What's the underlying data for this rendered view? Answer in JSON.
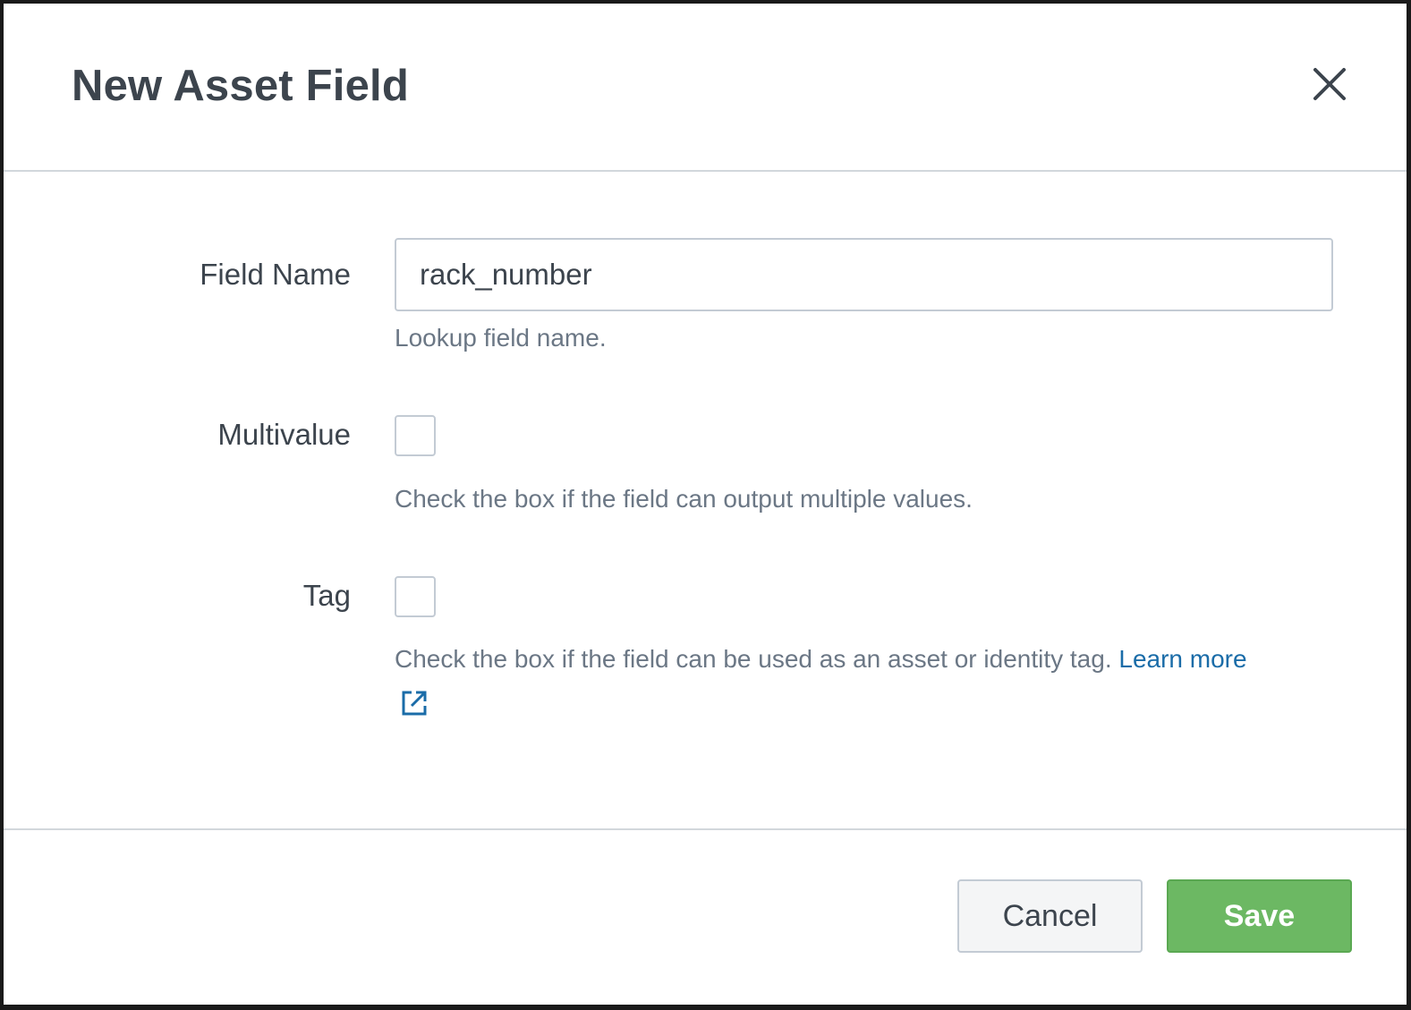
{
  "dialog": {
    "title": "New Asset Field"
  },
  "fields": {
    "field_name": {
      "label": "Field Name",
      "value": "rack_number",
      "help": "Lookup field name."
    },
    "multivalue": {
      "label": "Multivalue",
      "checked": false,
      "help": "Check the box if the field can output multiple values."
    },
    "tag": {
      "label": "Tag",
      "checked": false,
      "help": "Check the box if the field can be used as an asset or identity tag.",
      "link_text": "Learn more"
    }
  },
  "footer": {
    "cancel_label": "Cancel",
    "save_label": "Save"
  },
  "colors": {
    "save_green": "#6cb863",
    "link_blue": "#1a6ca8",
    "title_text": "#3c444d"
  },
  "icons": {
    "close": "close-icon",
    "external_link": "external-link-icon"
  }
}
